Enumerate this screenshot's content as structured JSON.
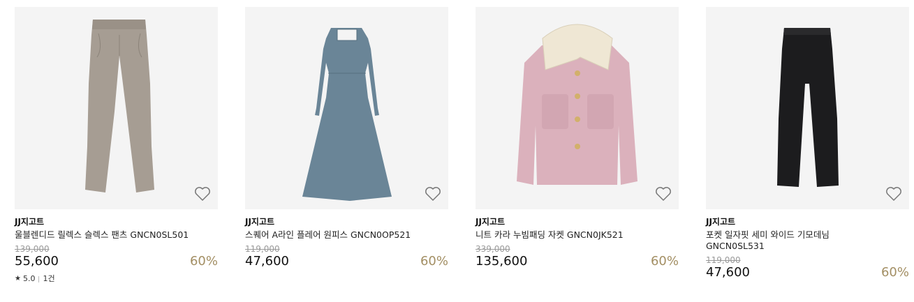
{
  "products": [
    {
      "brand": "JJ지고트",
      "name": "울블렌디드 릴렉스 슬렉스 팬츠 GNCN0SL501",
      "original_price": "139,000",
      "price": "55,600",
      "discount": "60%",
      "rating": "5.0",
      "review_count": "1건",
      "image_icon": "beige-pants-image"
    },
    {
      "brand": "JJ지고트",
      "name": "스퀘어 A라인 플레어 원피스 GNCN0OP521",
      "original_price": "119,000",
      "price": "47,600",
      "discount": "60%",
      "image_icon": "blue-dress-image"
    },
    {
      "brand": "JJ지고트",
      "name": "니트 카라 누빔패딩 자켓 GNCN0JK521",
      "original_price": "339,000",
      "price": "135,600",
      "discount": "60%",
      "image_icon": "pink-jacket-image"
    },
    {
      "brand": "JJ지고트",
      "name_line1": "포켓 일자핏 세미 와이드 기모데님",
      "name_line2": "GNCN0SL531",
      "original_price": "119,000",
      "price": "47,600",
      "discount": "60%",
      "image_icon": "black-jeans-image"
    }
  ],
  "colors": {
    "discount": "#a38f64",
    "image_background": "#f4f4f4",
    "original_price": "#9a9a9a"
  },
  "icons": {
    "wishlist": "heart-outline-icon",
    "rating": "star-icon"
  }
}
